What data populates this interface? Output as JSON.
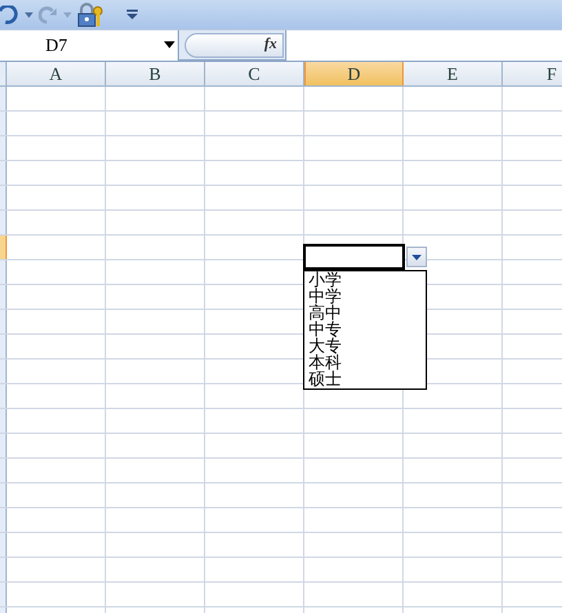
{
  "name_box": {
    "value": "D7"
  },
  "formula_bar": {
    "function_label": "fx"
  },
  "columns": [
    {
      "label": "A",
      "selected": false
    },
    {
      "label": "B",
      "selected": false
    },
    {
      "label": "C",
      "selected": false
    },
    {
      "label": "D",
      "selected": true
    },
    {
      "label": "E",
      "selected": false
    },
    {
      "label": "F",
      "selected": false
    }
  ],
  "rows": [
    {
      "selected": false
    },
    {
      "selected": false
    },
    {
      "selected": false
    },
    {
      "selected": false
    },
    {
      "selected": false
    },
    {
      "selected": false
    },
    {
      "selected": true
    },
    {
      "selected": false
    },
    {
      "selected": false
    },
    {
      "selected": false
    },
    {
      "selected": false
    },
    {
      "selected": false
    },
    {
      "selected": false
    },
    {
      "selected": false
    },
    {
      "selected": false
    },
    {
      "selected": false
    },
    {
      "selected": false
    },
    {
      "selected": false
    },
    {
      "selected": false
    },
    {
      "selected": false
    },
    {
      "selected": false
    },
    {
      "selected": false
    }
  ],
  "dropdown_list": {
    "items": [
      "小学",
      "中学",
      "高中",
      "中专",
      "大专",
      "本科",
      "硕士"
    ]
  }
}
